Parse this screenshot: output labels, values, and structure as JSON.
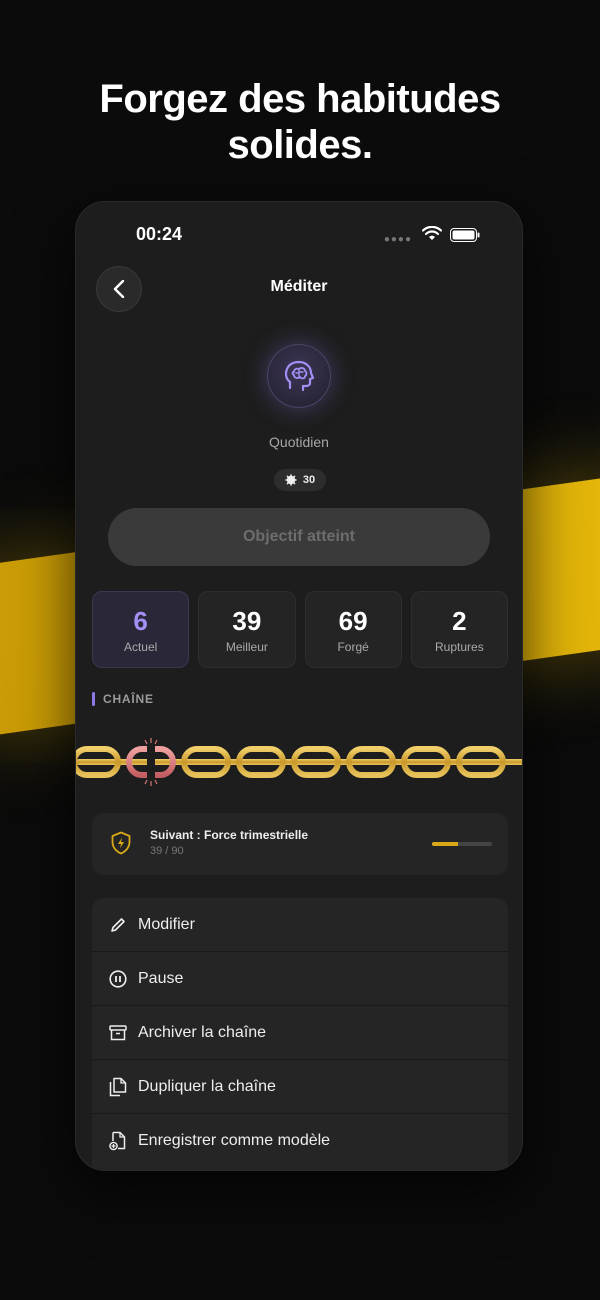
{
  "headline": "Forgez des habitudes solides.",
  "status": {
    "time": "00:24"
  },
  "nav": {
    "title": "Méditer",
    "back_icon": "chevron-left-icon"
  },
  "habit": {
    "icon": "brain-head-icon",
    "frequency": "Quotidien",
    "badge_value": "30",
    "accent_color": "#a48ff5"
  },
  "goal_button": {
    "label": "Objectif atteint",
    "state": "disabled"
  },
  "stats": [
    {
      "value": "6",
      "label": "Actuel"
    },
    {
      "value": "39",
      "label": "Meilleur"
    },
    {
      "value": "69",
      "label": "Forgé"
    },
    {
      "value": "2",
      "label": "Ruptures"
    }
  ],
  "section": {
    "label": "CHAÎNE"
  },
  "next_milestone": {
    "title": "Suivant : Force trimestrielle",
    "progress_text": "39 / 90",
    "progress": 0.433,
    "icon": "lightning-shield-icon"
  },
  "actions": [
    {
      "label": "Modifier",
      "icon": "pencil-icon"
    },
    {
      "label": "Pause",
      "icon": "pause-circle-icon"
    },
    {
      "label": "Archiver la chaîne",
      "icon": "archive-box-icon"
    },
    {
      "label": "Dupliquer la chaîne",
      "icon": "duplicate-doc-icon"
    },
    {
      "label": "Enregistrer comme modèle",
      "icon": "save-template-icon"
    }
  ],
  "colors": {
    "background": "#0b0b0b",
    "band": "#e6b80a",
    "chain_gold": "#d9b042",
    "chain_broken": "#d87576",
    "accent": "#a48ff5"
  }
}
